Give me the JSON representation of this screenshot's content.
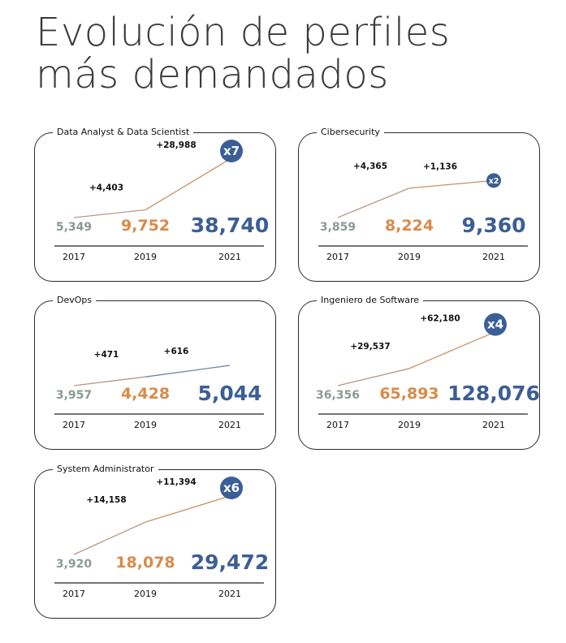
{
  "title_line1": "Evolución de perfiles",
  "title_line2": "más demandados",
  "colors": {
    "gray": "#8b9a94",
    "orange": "#d98a4a",
    "blue": "#3b5e96",
    "axis": "#222222"
  },
  "chart_data": [
    {
      "type": "line",
      "title": "Data Analyst & Data Scientist",
      "x": [
        "2017",
        "2019",
        "2021"
      ],
      "values": [
        5349,
        9752,
        38740
      ],
      "value_labels": [
        "5,349",
        "9,752",
        "38,740"
      ],
      "increments": [
        "+4,403",
        "+28,988"
      ],
      "multiplier": "x7"
    },
    {
      "type": "line",
      "title": "Cibersecurity",
      "x": [
        "2017",
        "2019",
        "2021"
      ],
      "values": [
        3859,
        8224,
        9360
      ],
      "value_labels": [
        "3,859",
        "8,224",
        "9,360"
      ],
      "increments": [
        "+4,365",
        "+1,136"
      ],
      "multiplier": "x2"
    },
    {
      "type": "line",
      "title": "DevOps",
      "x": [
        "2017",
        "2019",
        "2021"
      ],
      "values": [
        3957,
        4428,
        5044
      ],
      "value_labels": [
        "3,957",
        "4,428",
        "5,044"
      ],
      "increments": [
        "+471",
        "+616"
      ],
      "multiplier": ""
    },
    {
      "type": "line",
      "title": "Ingeniero de Software",
      "x": [
        "2017",
        "2019",
        "2021"
      ],
      "values": [
        36356,
        65893,
        128076
      ],
      "value_labels": [
        "36,356",
        "65,893",
        "128,076"
      ],
      "increments": [
        "+29,537",
        "+62,180"
      ],
      "multiplier": "x4"
    },
    {
      "type": "line",
      "title": "System Administrator",
      "x": [
        "2017",
        "2019",
        "2021"
      ],
      "values": [
        3920,
        18078,
        29472
      ],
      "value_labels": [
        "3,920",
        "18,078",
        "29,472"
      ],
      "increments": [
        "+14,158",
        "+11,394"
      ],
      "multiplier": "x6"
    }
  ]
}
